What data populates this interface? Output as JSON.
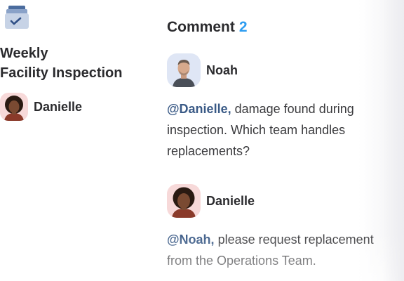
{
  "task": {
    "title_line1": "Weekly",
    "title_line2": "Facility Inspection",
    "icon": "inbox-check-icon",
    "assignee": {
      "name": "Danielle",
      "avatar": "avatar-danielle"
    }
  },
  "comments": {
    "heading": "Comment",
    "count": "2",
    "items": [
      {
        "author": "Noah",
        "avatar": "avatar-noah",
        "mention": "@Danielle,",
        "text": " damage found during inspection. Which team handles replacements?"
      },
      {
        "author": "Danielle",
        "avatar": "avatar-danielle",
        "mention": "@Noah,",
        "text": " please request replacement from the Operations Team."
      }
    ]
  },
  "colors": {
    "accent": "#2d9cf0",
    "mention": "#3a5a86",
    "icon_blue": "#4b73b8"
  }
}
